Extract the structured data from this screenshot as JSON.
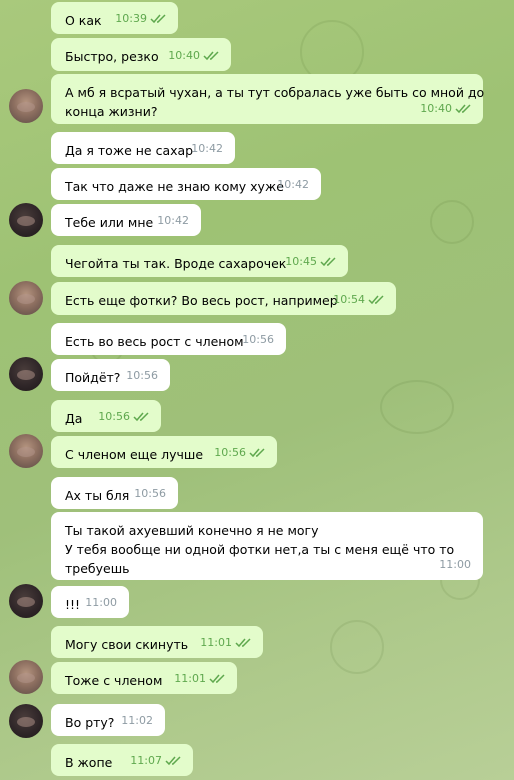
{
  "messages": [
    {
      "text": "О как",
      "time": "10:39",
      "out": true
    },
    {
      "text": "Быстро, резко",
      "time": "10:40",
      "out": true
    },
    {
      "lines": [
        "А мб я всратый чухан, а ты тут собралась уже быть со мной до",
        "конца жизни?"
      ],
      "time": "10:40",
      "out": true
    },
    {
      "text": "Да я тоже не сахар",
      "time": "10:42",
      "out": false
    },
    {
      "text": "Так что даже не знаю кому хуже",
      "time": "10:42",
      "out": false
    },
    {
      "text": "Тебе или мне",
      "time": "10:42",
      "out": false
    },
    {
      "text": "Чегойта ты так. Вроде сахарочек",
      "time": "10:45",
      "out": true
    },
    {
      "text": "Есть еще фотки? Во весь рост, например",
      "time": "10:54",
      "out": true
    },
    {
      "text": "Есть во весь рост с членом",
      "time": "10:56",
      "out": false
    },
    {
      "text": "Пойдёт?",
      "time": "10:56",
      "out": false
    },
    {
      "text": "Да",
      "time": "10:56",
      "out": true
    },
    {
      "text": "С членом еще лучше",
      "time": "10:56",
      "out": true
    },
    {
      "text": "Ах ты бля",
      "time": "10:56",
      "out": false
    },
    {
      "lines": [
        "Ты такой ахуевший конечно я не могу",
        "У тебя вообще ни одной фотки нет,а ты с меня ещё что то",
        "требуешь"
      ],
      "time": "11:00",
      "out": false
    },
    {
      "text": "!!!",
      "time": "11:00",
      "out": false
    },
    {
      "text": "Могу свои скинуть",
      "time": "11:01",
      "out": true
    },
    {
      "text": "Тоже с членом",
      "time": "11:01",
      "out": true
    },
    {
      "text": "Во рту?",
      "time": "11:02",
      "out": false
    },
    {
      "text": "В жопе",
      "time": "11:07",
      "out": true
    }
  ]
}
